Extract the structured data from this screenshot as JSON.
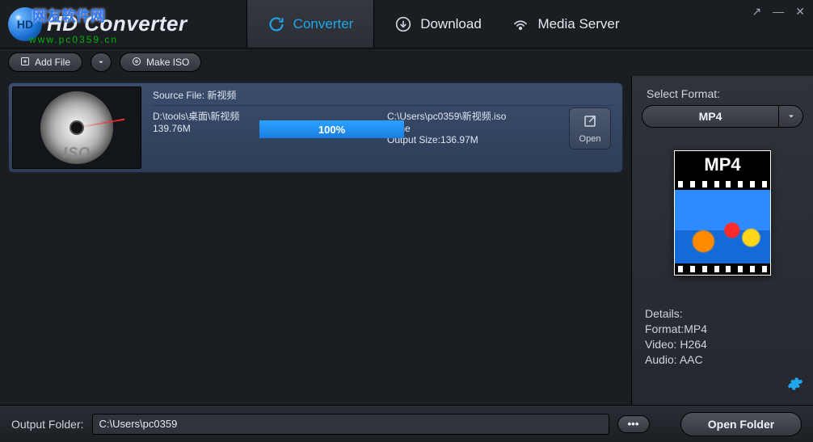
{
  "header": {
    "app_title": "HD Converter",
    "overlay_cn": "网友软件网",
    "overlay_url": "www.pc0359.cn",
    "tabs": [
      {
        "label": "Converter",
        "icon": "refresh-icon"
      },
      {
        "label": "Download",
        "icon": "download-icon"
      },
      {
        "label": "Media Server",
        "icon": "wifi-icon"
      }
    ]
  },
  "toolbar": {
    "add_file_label": "Add File",
    "make_iso_label": "Make ISO"
  },
  "job": {
    "thumb_label": "ISO",
    "source_prefix": "Source File:",
    "source_name": "新视频",
    "input_path": "D:\\tools\\桌面\\新视频",
    "input_size": "139.76M",
    "output_path": "C:\\Users\\pc0359\\新视频.iso",
    "status": "Done",
    "output_size_label": "Output Size:",
    "output_size": "136.97M",
    "progress_text": "100%",
    "progress_pct": 100,
    "open_label": "Open"
  },
  "sidebar": {
    "select_format_label": "Select Format:",
    "selected_format": "MP4",
    "card_label": "MP4",
    "details_heading": "Details:",
    "details_format": "Format:MP4",
    "details_video": "Video: H264",
    "details_audio": "Audio: AAC"
  },
  "footer": {
    "output_folder_label": "Output Folder:",
    "output_folder_value": "C:\\Users\\pc0359",
    "browse_label": "•••",
    "open_folder_label": "Open Folder"
  }
}
